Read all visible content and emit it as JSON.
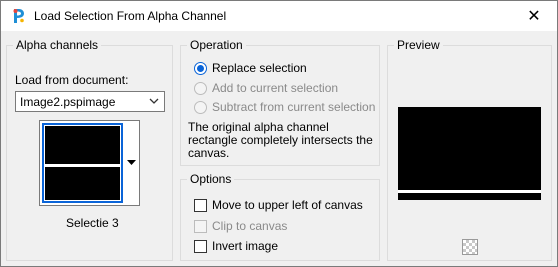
{
  "window": {
    "title": "Load Selection From Alpha Channel",
    "close_glyph": "✕",
    "icon": "paintshop-icon"
  },
  "alpha": {
    "group_label": "Alpha channels",
    "load_label": "Load from document:",
    "document_value": "Image2.pspimage",
    "channel_name": "Selectie 3"
  },
  "operation": {
    "group_label": "Operation",
    "options": [
      {
        "label": "Replace selection",
        "checked": true,
        "enabled": true
      },
      {
        "label": "Add to current selection",
        "checked": false,
        "enabled": false
      },
      {
        "label": "Subtract from current selection",
        "checked": false,
        "enabled": false
      }
    ],
    "description": "The original alpha channel rectangle completely intersects the canvas."
  },
  "options": {
    "group_label": "Options",
    "checks": [
      {
        "label": "Move to upper left of canvas",
        "checked": false,
        "enabled": true
      },
      {
        "label": "Clip to canvas",
        "checked": false,
        "enabled": false
      },
      {
        "label": "Invert image",
        "checked": false,
        "enabled": true
      }
    ]
  },
  "preview": {
    "group_label": "Preview"
  },
  "colors": {
    "accent": "#0a64d8",
    "background": "#f0f0f0",
    "disabled": "#8a8a8a"
  }
}
